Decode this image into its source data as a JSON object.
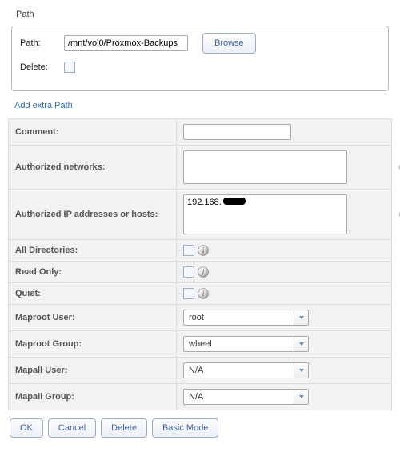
{
  "path_section": {
    "title": "Path",
    "path_label": "Path:",
    "path_value": "/mnt/vol0/Proxmox-Backups",
    "browse_label": "Browse",
    "delete_label": "Delete:",
    "add_link": "Add extra Path"
  },
  "rows": {
    "comment_label": "Comment:",
    "comment_value": "",
    "auth_net_label": "Authorized networks:",
    "auth_net_value": "",
    "auth_ip_label": "Authorized IP addresses or hosts:",
    "auth_ip_value": "192.168.",
    "all_dirs_label": "All Directories:",
    "read_only_label": "Read Only:",
    "quiet_label": "Quiet:",
    "maproot_user_label": "Maproot User:",
    "maproot_user_value": "root",
    "maproot_group_label": "Maproot Group:",
    "maproot_group_value": "wheel",
    "mapall_user_label": "Mapall User:",
    "mapall_user_value": "N/A",
    "mapall_group_label": "Mapall Group:",
    "mapall_group_value": "N/A"
  },
  "buttons": {
    "ok": "OK",
    "cancel": "Cancel",
    "delete": "Delete",
    "basic": "Basic Mode"
  }
}
